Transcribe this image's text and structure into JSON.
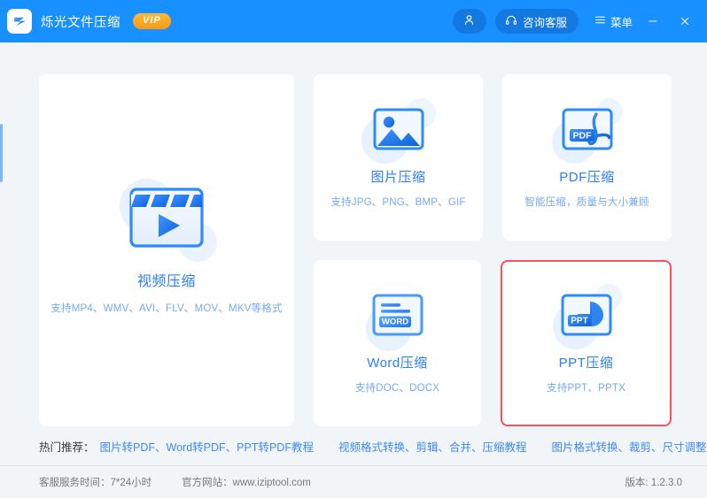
{
  "titlebar": {
    "app_title": "烁光文件压缩",
    "vip_badge": "VIP",
    "service_label": "咨询客服",
    "menu_label": "菜单",
    "brand_color": "#1890ff",
    "vip_color": "#fa9a16"
  },
  "cards": {
    "video": {
      "title": "视频压缩",
      "subtitle": "支持MP4、WMV、AVI、FLV、MOV、MKV等格式"
    },
    "image": {
      "title": "图片压缩",
      "subtitle": "支持JPG、PNG、BMP、GIF"
    },
    "pdf": {
      "title": "PDF压缩",
      "subtitle": "智能压缩，质量与大小兼顾",
      "icon_text": "PDF"
    },
    "word": {
      "title": "Word压缩",
      "subtitle": "支持DOC、DOCX",
      "icon_text": "WORD"
    },
    "ppt": {
      "title": "PPT压缩",
      "subtitle": "支持PPT、PPTX",
      "icon_text": "PPT",
      "highlight_color": "#f5535b"
    }
  },
  "recommend": {
    "label": "热门推荐：",
    "links": [
      "图片转PDF、Word转PDF、PPT转PDF教程",
      "视频格式转换、剪辑、合并、压缩教程",
      "图片格式转换、裁剪、尺寸调整、证件照大小调整"
    ]
  },
  "footer": {
    "service_hours": "客服服务时间：7*24小时",
    "website": "官方网站：www.iziptool.com",
    "version": "版本: 1.2.3.0"
  }
}
